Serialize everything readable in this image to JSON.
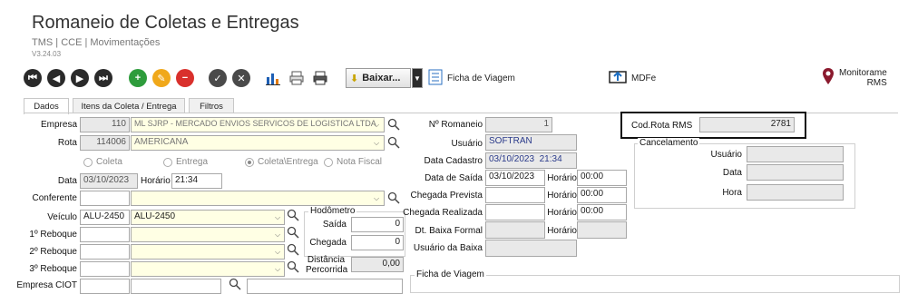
{
  "header": {
    "title": "Romaneio de Coletas e Entregas",
    "breadcrumb": "TMS | CCE | Movimentações",
    "version": "V3.24.03"
  },
  "toolbar": {
    "baixar_label": "Baixar...",
    "ficha_label": "Ficha de Viagem",
    "mdfe_label": "MDFe",
    "monitoramento_line1": "Monitorame",
    "monitoramento_line2": "RMS"
  },
  "tabs": [
    {
      "label": "Dados"
    },
    {
      "label": "Itens da Coleta / Entrega"
    },
    {
      "label": "Filtros"
    }
  ],
  "form": {
    "empresa_label": "Empresa",
    "empresa_code": "110",
    "empresa_name": "ML SJRP - MERCADO ENVIOS SERVICOS DE LOGISTICA LTDA",
    "rota_label": "Rota",
    "rota_code": "114006",
    "rota_name": "AMERICANA",
    "radio_coleta": "Coleta",
    "radio_entrega": "Entrega",
    "radio_coleta_entrega": "Coleta\\Entrega",
    "radio_nota_fiscal": "Nota Fiscal",
    "data_label": "Data",
    "data_value": "03/10/2023",
    "horario_label": "Horário",
    "horario_value": "21:34",
    "conferente_label": "Conferente",
    "veiculo_label": "Veículo",
    "veiculo_code": "ALU-2450",
    "veiculo_name": "ALU-2450",
    "reboque1_label": "1º Reboque",
    "reboque2_label": "2º Reboque",
    "reboque3_label": "3º Reboque",
    "empresa_ciot_label": "Empresa CIOT",
    "hodometro_label": "Hodômetro",
    "saida_label": "Saída",
    "saida_value": "0",
    "chegada_label": "Chegada",
    "chegada_value": "0",
    "distancia_label1": "Distância",
    "distancia_label2": "Percorrida",
    "distancia_value": "0,00"
  },
  "middle": {
    "romaneio_label": "Nº Romaneio",
    "romaneio_value": "1",
    "usuario_label": "Usuário",
    "usuario_value": "SOFTRAN",
    "data_cadastro_label": "Data Cadastro",
    "data_cadastro_value": "03/10/2023  21:34",
    "data_saida_label": "Data de Saída",
    "data_saida_value": "03/10/2023",
    "horario_saida_label": "Horário",
    "horario_saida_value": "00:00",
    "chegada_prevista_label": "Chegada Prevista",
    "horario_prevista_label": "Horário",
    "horario_prevista_value": "00:00",
    "chegada_realizada_label": "Chegada Realizada",
    "horario_realizada_label": "Horário",
    "horario_realizada_value": "00:00",
    "dt_baixa_label": "Dt. Baixa Formal",
    "horario_baixa_label": "Horário",
    "usuario_baixa_label": "Usuário da Baixa",
    "ficha_viagem_label": "Ficha de Viagem"
  },
  "right": {
    "cod_rota_label": "Cod.Rota RMS",
    "cod_rota_value": "2781",
    "cancelamento_label": "Cancelamento",
    "usuario_label": "Usuário",
    "data_label": "Data",
    "hora_label": "Hora"
  },
  "colors": {
    "readonly_bg": "#e9e9e9",
    "yellow_bg": "#ffffe4",
    "add_green": "#2e9c3c",
    "edit_orange": "#f0a81a",
    "delete_red": "#d9302c",
    "monitor_pin": "#8b1a2e"
  }
}
